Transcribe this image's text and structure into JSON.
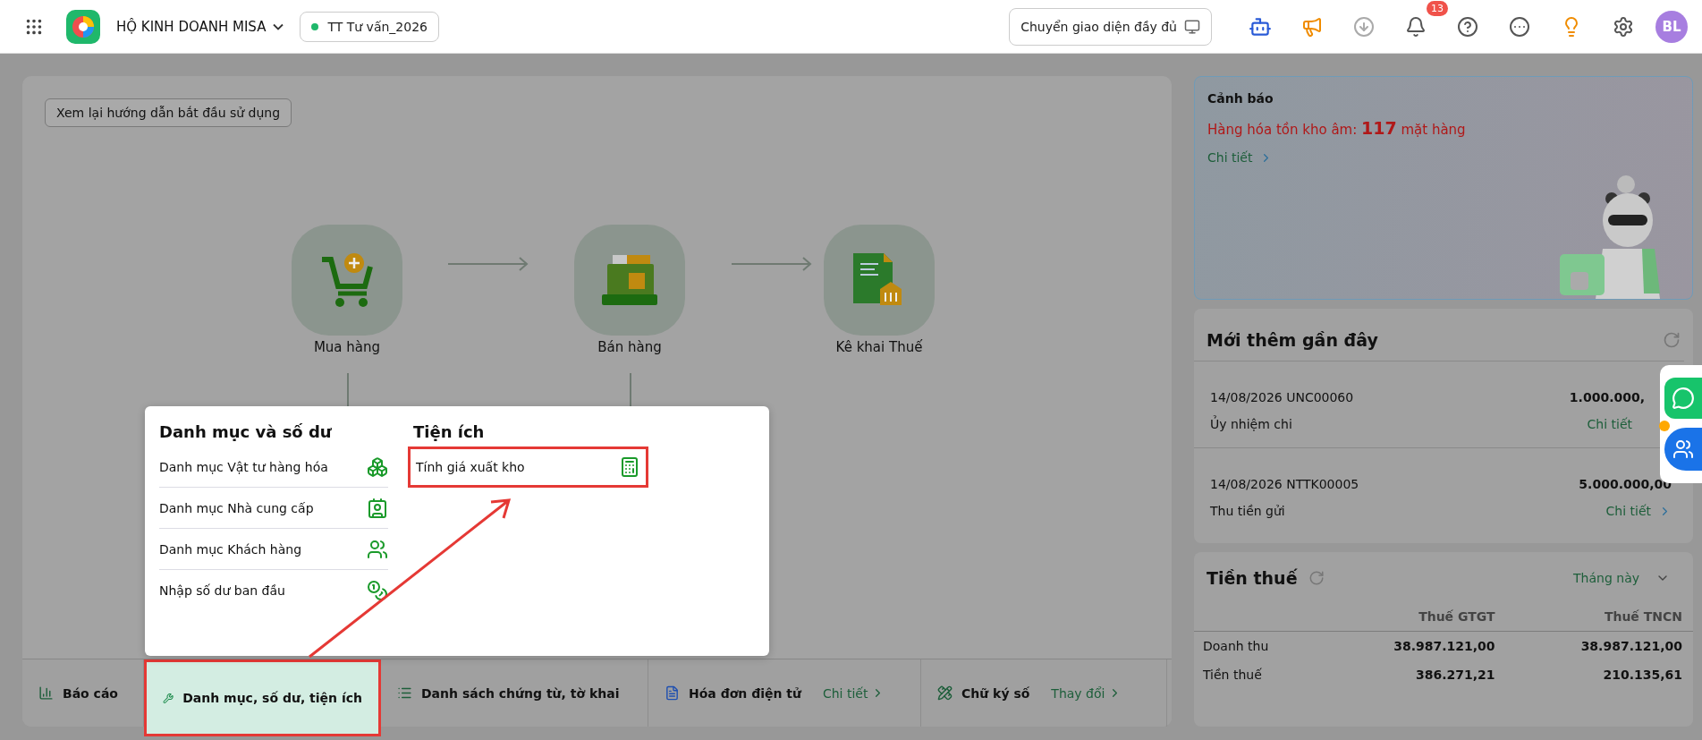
{
  "topbar": {
    "company": "HỘ KINH DOANH MISA",
    "workspace": "TT Tư vấn_2026",
    "switch_button": "Chuyển giao diện đầy đủ",
    "notification_count": "13",
    "avatar": "BL"
  },
  "guide_button": "Xem lại hướng dẫn bắt đầu sử dụng",
  "flow": [
    {
      "label": "Mua hàng",
      "kind": "cart"
    },
    {
      "label": "Bán hàng",
      "kind": "register"
    },
    {
      "label": "Kê khai Thuế",
      "kind": "tax"
    }
  ],
  "popup": {
    "columns": [
      {
        "title": "Danh mục và số dư",
        "items": [
          {
            "label": "Danh mục Vật tư hàng hóa",
            "kind": "goods",
            "highlighted": false
          },
          {
            "label": "Danh mục Nhà cung cấp",
            "kind": "supplier",
            "highlighted": false
          },
          {
            "label": "Danh mục Khách hàng",
            "kind": "customer",
            "highlighted": false
          },
          {
            "label": "Nhập số dư ban đầu",
            "kind": "balance",
            "highlighted": false
          }
        ]
      },
      {
        "title": "Tiện ích",
        "items": [
          {
            "label": "Tính giá xuất kho",
            "kind": "pricing",
            "highlighted": true
          }
        ]
      }
    ]
  },
  "bottom_bar": [
    {
      "label": "Báo cáo",
      "kind": "chart",
      "selected": false
    },
    {
      "label": "Danh mục, số dư, tiện ích",
      "kind": "wrench",
      "selected": true
    },
    {
      "label": "Danh sách chứng từ, tờ khai",
      "kind": "list",
      "selected": false
    },
    {
      "label": "Hóa đơn điện tử",
      "kind": "invoice",
      "link": "Chi tiết",
      "selected": false
    },
    {
      "label": "Chữ ký số",
      "kind": "signature",
      "link": "Thay đổi",
      "selected": false
    }
  ],
  "warning": {
    "title": "Cảnh báo",
    "message": "Hàng hóa tồn kho âm: **117** mặt hàng",
    "link": "Chi tiết"
  },
  "recent": {
    "title": "Mới thêm gần đây",
    "items": [
      {
        "date": "14/08/2026",
        "code": "UNC00060",
        "amount": "1.000.000,",
        "type": "Ủy nhiệm chi",
        "link": "Chi tiết"
      },
      {
        "date": "14/08/2026",
        "code": "NTTK00005",
        "amount": "5.000.000,00",
        "type": "Thu tiền gửi",
        "link": "Chi tiết"
      }
    ]
  },
  "tax": {
    "title": "Tiền thuế",
    "period": "Tháng này",
    "columns": [
      "Thuế GTGT",
      "Thuế TNCN"
    ],
    "rows": [
      {
        "label": "Doanh thu",
        "values": [
          "38.987.121,00",
          "38.987.121,00"
        ]
      },
      {
        "label": "Tiền thuế",
        "values": [
          "386.271,21",
          "210.135,61"
        ]
      }
    ]
  }
}
